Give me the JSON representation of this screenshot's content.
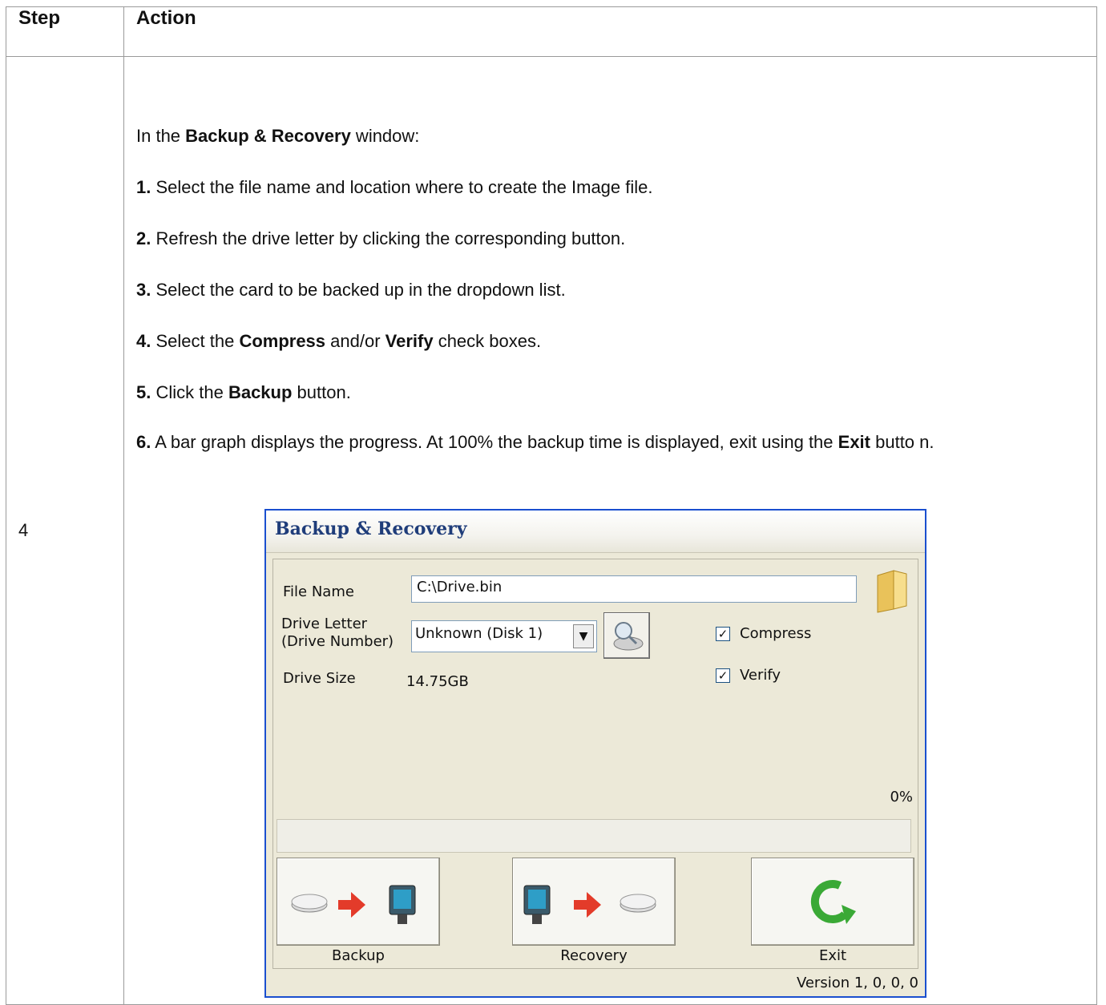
{
  "table": {
    "header": {
      "step": "Step",
      "action": "Action"
    },
    "step_number": "4",
    "intro": {
      "pre": "In the ",
      "bold": "Backup & Recovery",
      "post": " window:"
    },
    "steps": [
      {
        "num": "1.",
        "text": " Select the file name and location where to create the Image file."
      },
      {
        "num": "2.",
        "text": " Refresh the drive letter by clicking the corresponding button."
      },
      {
        "num": "3.",
        "text": " Select the card to be backed up in the dropdown list."
      }
    ],
    "step4": {
      "num": "4.",
      "a": " Select the ",
      "b1": "Compress",
      "c": " and/or ",
      "b2": "Verify",
      "d": " check boxes."
    },
    "step5": {
      "num": "5.",
      "a": " Click the ",
      "b": "Backup",
      "c": " button."
    },
    "step6": {
      "num": "6.",
      "a": " A bar graph displays the progress. At 100% the backup time is displayed, exit using the  ",
      "b": "Exit",
      "c": " butto n."
    }
  },
  "dialog": {
    "title": "Backup & Recovery",
    "file_name_label": "File Name",
    "file_name_value": "C:\\Drive.bin",
    "drive_letter_label_1": "Drive Letter",
    "drive_letter_label_2": "(Drive Number)",
    "drive_select_value": "Unknown (Disk 1)",
    "drive_size_label": "Drive Size",
    "drive_size_value": "14.75GB",
    "compress_label": "Compress",
    "compress_checked": true,
    "verify_label": "Verify",
    "verify_checked": true,
    "progress_percent_text": "0%",
    "progress_value": 0,
    "backup_label": "Backup",
    "recovery_label": "Recovery",
    "exit_label": "Exit",
    "version": "Version 1, 0, 0, 0",
    "icons": [
      "folder-icon",
      "refresh-drive-icon",
      "drive-icon",
      "arrow-right-icon",
      "computer-icon",
      "exit-arrow-icon"
    ]
  }
}
